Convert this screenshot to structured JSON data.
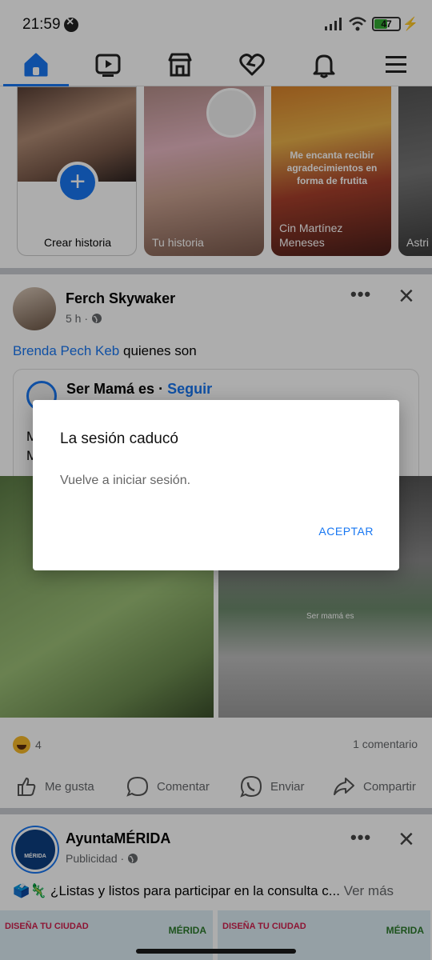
{
  "status_bar": {
    "time": "21:59",
    "battery": "47"
  },
  "nav": {
    "items": [
      "home",
      "video",
      "marketplace",
      "dating",
      "notifications",
      "menu"
    ]
  },
  "stories": {
    "create_label": "Crear historia",
    "items": [
      {
        "label": "Tu historia"
      },
      {
        "label": "Cin Martínez Meneses",
        "overlay_text": "Me encanta recibir agradecimientos en forma de frutita"
      },
      {
        "label": "Astri"
      }
    ]
  },
  "post": {
    "author": "Ferch Skywaker",
    "time": "5 h",
    "text_link": "Brenda Pech Keb",
    "text_rest": " quienes son",
    "shared_page": "Ser Mamá es",
    "follow": "Seguir",
    "shared_text": "M\nM",
    "media_caption": "Ser mamá es",
    "reaction_count": "4",
    "comments": "1 comentario",
    "actions": {
      "like": "Me gusta",
      "comment": "Comentar",
      "send": "Enviar",
      "share": "Compartir"
    }
  },
  "post2": {
    "author": "AyuntaMÉRIDA",
    "audience": "Publicidad",
    "logo_text": "MÉRIDA",
    "text": "🗳️🦎 ¿Listas y listos para participar en la consulta c...",
    "see_more": "Ver más",
    "banner_brand": "DISEÑA TU CIUDAD",
    "banner_city": "MÉRIDA"
  },
  "dialog": {
    "title": "La sesión caducó",
    "message": "Vuelve a iniciar sesión.",
    "button": "ACEPTAR"
  },
  "colors": {
    "accent": "#1877f2",
    "overlay": "rgba(0,0,0,0.32)"
  }
}
